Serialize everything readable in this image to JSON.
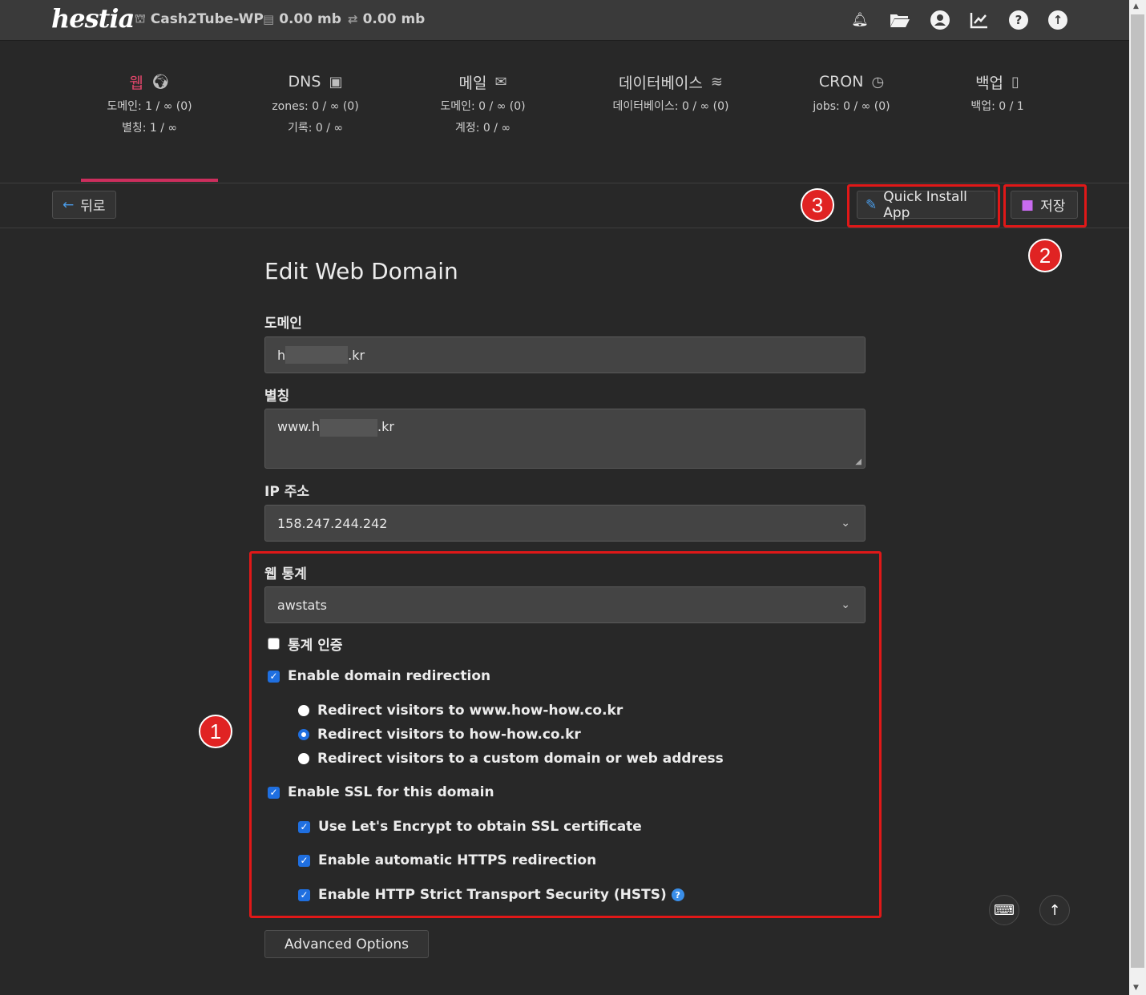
{
  "topbar": {
    "logo": "hestia",
    "user": "Cash2Tube-WP",
    "disk": "0.00 mb",
    "bandwidth": "0.00 mb"
  },
  "nav": [
    {
      "title": "웹",
      "line1": "도메인: 1 / ∞ (0)",
      "line2": "별칭: 1 / ∞"
    },
    {
      "title": "DNS",
      "line1": "zones: 0 / ∞ (0)",
      "line2": "기록: 0 / ∞"
    },
    {
      "title": "메일",
      "line1": "도메인: 0 / ∞ (0)",
      "line2": "계정: 0 / ∞"
    },
    {
      "title": "데이터베이스",
      "line1": "데이터베이스: 0 / ∞ (0)",
      "line2": ""
    },
    {
      "title": "CRON",
      "line1": "jobs: 0 / ∞ (0)",
      "line2": ""
    },
    {
      "title": "백업",
      "line1": "백업: 0 / 1",
      "line2": ""
    }
  ],
  "toolbar": {
    "back": "뒤로",
    "quick_install": "Quick Install App",
    "save": "저장"
  },
  "badges": [
    "1",
    "2",
    "3"
  ],
  "form": {
    "title": "Edit Web Domain",
    "domain_label": "도메인",
    "domain_prefix": "h",
    "domain_suffix": ".kr",
    "alias_label": "별칭",
    "alias_prefix": "www.h",
    "alias_suffix": ".kr",
    "ip_label": "IP 주소",
    "ip_value": "158.247.244.242",
    "stats_label": "웹 통계",
    "stats_value": "awstats",
    "stats_auth": "통계 인증",
    "redirect_enable": "Enable domain redirection",
    "redirect_options": [
      "Redirect visitors to www.how-how.co.kr",
      "Redirect visitors to how-how.co.kr",
      "Redirect visitors to a custom domain or web address"
    ],
    "ssl_enable": "Enable SSL for this domain",
    "ssl_letsencrypt": "Use Let's Encrypt to obtain SSL certificate",
    "ssl_https": "Enable automatic HTTPS redirection",
    "ssl_hsts": "Enable HTTP Strict Transport Security (HSTS)",
    "advanced": "Advanced Options"
  },
  "colors": {
    "accent_active": "#e2466b",
    "highlight_box": "#e01818",
    "checkbox": "#1f6fe0"
  }
}
